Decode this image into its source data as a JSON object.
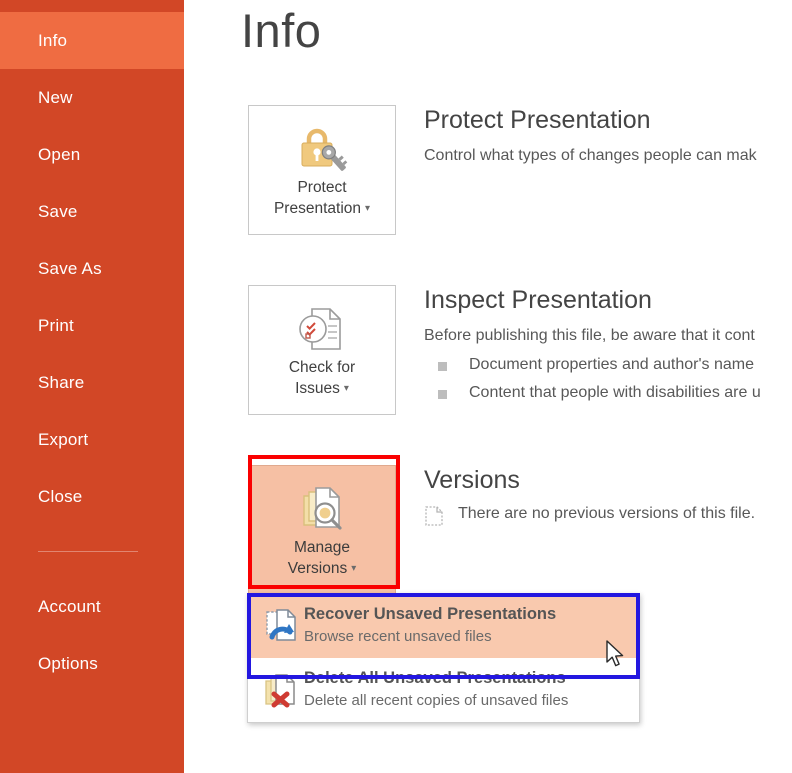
{
  "sidebar": {
    "background_color": "#d24726",
    "selected_color": "#ef6c42",
    "items": [
      {
        "label": "Info",
        "selected": true
      },
      {
        "label": "New",
        "selected": false
      },
      {
        "label": "Open",
        "selected": false
      },
      {
        "label": "Save",
        "selected": false
      },
      {
        "label": "Save As",
        "selected": false
      },
      {
        "label": "Print",
        "selected": false
      },
      {
        "label": "Share",
        "selected": false
      },
      {
        "label": "Export",
        "selected": false
      },
      {
        "label": "Close",
        "selected": false
      }
    ],
    "items_after_separator": [
      {
        "label": "Account",
        "selected": false
      },
      {
        "label": "Options",
        "selected": false
      }
    ]
  },
  "page": {
    "title": "Info"
  },
  "sections": {
    "protect": {
      "button_label_line1": "Protect",
      "button_label_line2": "Presentation",
      "button_icon": "lock-and-key-icon",
      "heading": "Protect Presentation",
      "description": "Control what types of changes people can mak"
    },
    "inspect": {
      "button_label_line1": "Check for",
      "button_label_line2": "Issues",
      "button_icon": "document-inspect-icon",
      "heading": "Inspect Presentation",
      "description": "Before publishing this file, be aware that it cont",
      "bullets": [
        "Document properties and author's name",
        "Content that people with disabilities are u"
      ]
    },
    "versions": {
      "button_label_line1": "Manage",
      "button_label_line2": "Versions",
      "button_icon": "manage-versions-icon",
      "button_highlight_color": "#f6c0a4",
      "highlight_border_color": "#fa0000",
      "heading": "Versions",
      "row_icon": "empty-document-icon",
      "row_text": "There are no previous versions of this file."
    }
  },
  "dropdown": {
    "highlight_border_color": "#2317e0",
    "items": [
      {
        "icon": "recover-document-icon",
        "title": "Recover Unsaved Presentations",
        "subtitle": "Browse recent unsaved files",
        "active": true
      },
      {
        "icon": "delete-documents-icon",
        "title": "Delete All Unsaved Presentations",
        "subtitle": "Delete all recent copies of unsaved files",
        "active": false
      }
    ]
  },
  "cursor": {
    "icon": "mouse-pointer-icon"
  }
}
